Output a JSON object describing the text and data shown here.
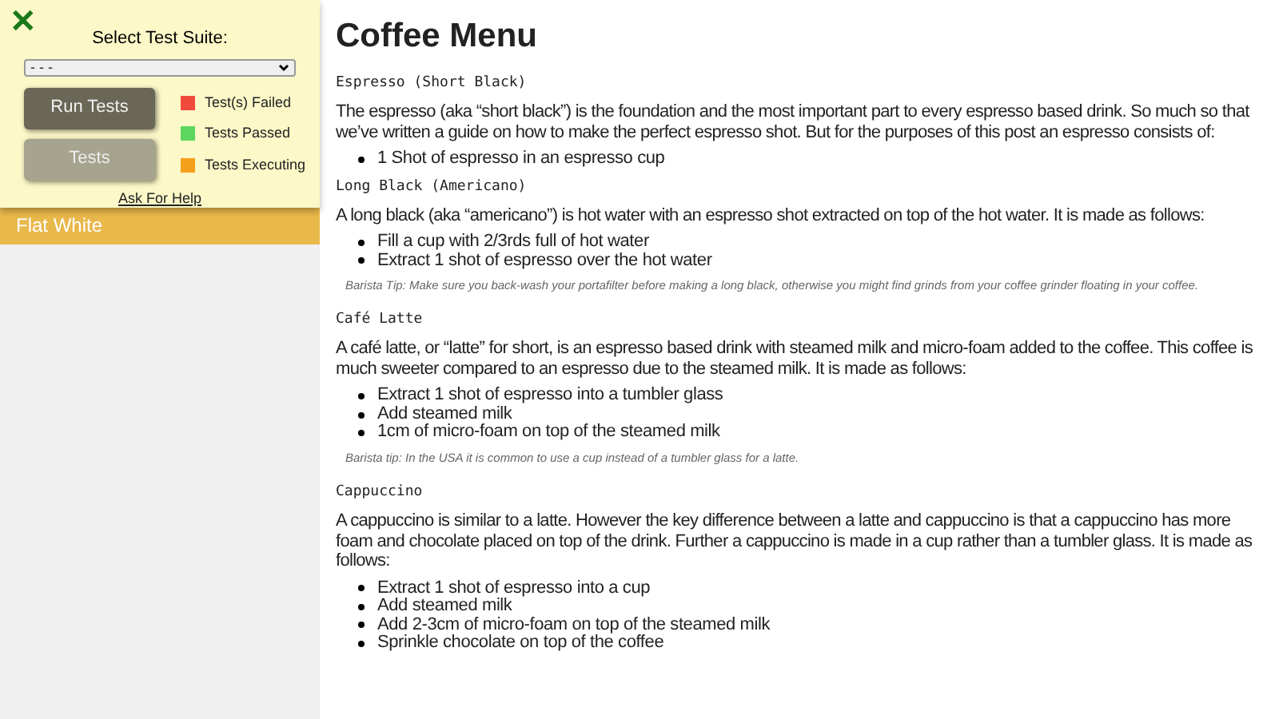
{
  "test_panel": {
    "close": "✕",
    "title": "Select Test Suite:",
    "select_value": "- - -",
    "buttons": [
      {
        "label": "Run Tests",
        "disabled": false
      },
      {
        "label": "Tests",
        "disabled": true
      }
    ],
    "legend": [
      {
        "label": "Test(s) Failed",
        "color": "#f04a3c"
      },
      {
        "label": "Tests Passed",
        "color": "#5cd65c"
      },
      {
        "label": "Tests Executing",
        "color": "#f5a01a"
      }
    ],
    "help_link": "Ask For Help"
  },
  "sidebar": {
    "items": [
      {
        "label": "Flat White",
        "selected": true
      }
    ]
  },
  "main": {
    "title": "Coffee Menu",
    "sections": [
      {
        "heading": "Espresso (Short Black)",
        "paragraph": "The espresso (aka “short black”) is the foundation and the most important part to every espresso based drink. So much so that we’ve written a guide on how to make the perfect espresso shot. But for the purposes of this post an espresso consists of:",
        "items": [
          "1 Shot of espresso in an espresso cup"
        ]
      },
      {
        "heading": "Long Black (Americano)",
        "paragraph": "A long black (aka “americano”) is hot water with an espresso shot extracted on top of the hot water. It is made as follows:",
        "items": [
          "Fill a cup with 2/3rds full of hot water",
          "Extract 1 shot of espresso over the hot water"
        ],
        "tip": "Barista Tip: Make sure you back-wash your portafilter before making a long black, otherwise you might find grinds from your coffee grinder floating in your coffee."
      },
      {
        "heading": "Café Latte",
        "paragraph": "A café latte, or “latte” for short, is an espresso based drink with steamed milk and micro-foam added to the coffee. This coffee is much sweeter compared to an espresso due to the steamed milk. It is made as follows:",
        "items": [
          "Extract 1 shot of espresso into a tumbler glass",
          "Add steamed milk",
          "1cm of micro-foam on top of the steamed milk"
        ],
        "tip": "Barista tip: In the USA it is common to use a cup instead of a tumbler glass for a latte."
      },
      {
        "heading": "Cappuccino",
        "paragraph": "A cappuccino is similar to a latte. However the key difference between a latte and cappuccino is that a cappuccino has more foam and chocolate placed on top of the drink. Further a cappuccino is made in a cup rather than a tumbler glass. It is made as follows:",
        "items": [
          "Extract 1 shot of espresso into a cup",
          "Add steamed milk",
          "Add 2-3cm of micro-foam on top of the steamed milk",
          "Sprinkle chocolate on top of the coffee"
        ]
      }
    ]
  }
}
